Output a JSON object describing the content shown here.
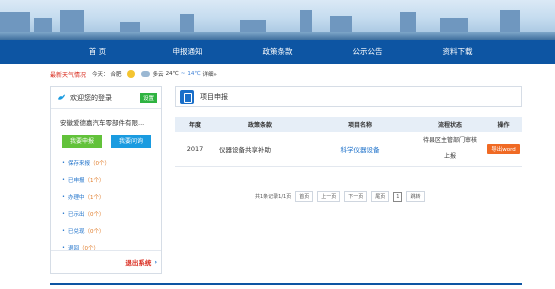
{
  "nav": {
    "items": [
      "首 页",
      "申报通知",
      "政策条款",
      "公示公告",
      "资料下载"
    ]
  },
  "weather": {
    "label": "最新天气情况",
    "day": "今天：",
    "city": "合肥",
    "cond": "多云",
    "temp_hi": "24℃",
    "temp_sep": "~",
    "temp_lo": "14℃",
    "detail": "详细»",
    "sun_color": "#f4c430",
    "cloud_color": "#9bb8d3"
  },
  "left": {
    "title": "欢迎您的登录",
    "settings": "设置",
    "company": "安徽爱德嘉汽车零部件有限...",
    "btn_apply": "我要申报",
    "btn_ask": "我要问询",
    "menu": [
      {
        "name": "保存来报",
        "count": "（0个）"
      },
      {
        "name": "已申报",
        "count": "（1个）"
      },
      {
        "name": "办理中",
        "count": "（1个）"
      },
      {
        "name": "已示出",
        "count": "（0个）"
      },
      {
        "name": "已兑现",
        "count": "（0个）"
      },
      {
        "name": "退回",
        "count": "（0个）"
      }
    ],
    "logout": "退出系统",
    "logout_arrow": "›"
  },
  "right": {
    "title": "项目申报",
    "columns": [
      "年度",
      "政策条款",
      "项目名称",
      "流程状态",
      "操作"
    ],
    "rows": [
      {
        "year": "2017",
        "policy": "仪器设备共享补助",
        "project": "科学仪器设备",
        "status_line1": "待县区主管部门审核",
        "status_line2": "上报",
        "action": "导出word"
      }
    ],
    "pager": {
      "summary": "共1条记录1/1页",
      "first": "首页",
      "prev": "上一页",
      "next": "下一页",
      "last": "尾页",
      "page": "1",
      "go": "跳转"
    }
  },
  "colors": {
    "nav_bg": "#0d55a3",
    "accent_red": "#d9291c",
    "accent_green": "#2fb341",
    "accent_blue": "#1a9be0",
    "link_blue": "#1a6fc9",
    "orange": "#f06a24"
  }
}
